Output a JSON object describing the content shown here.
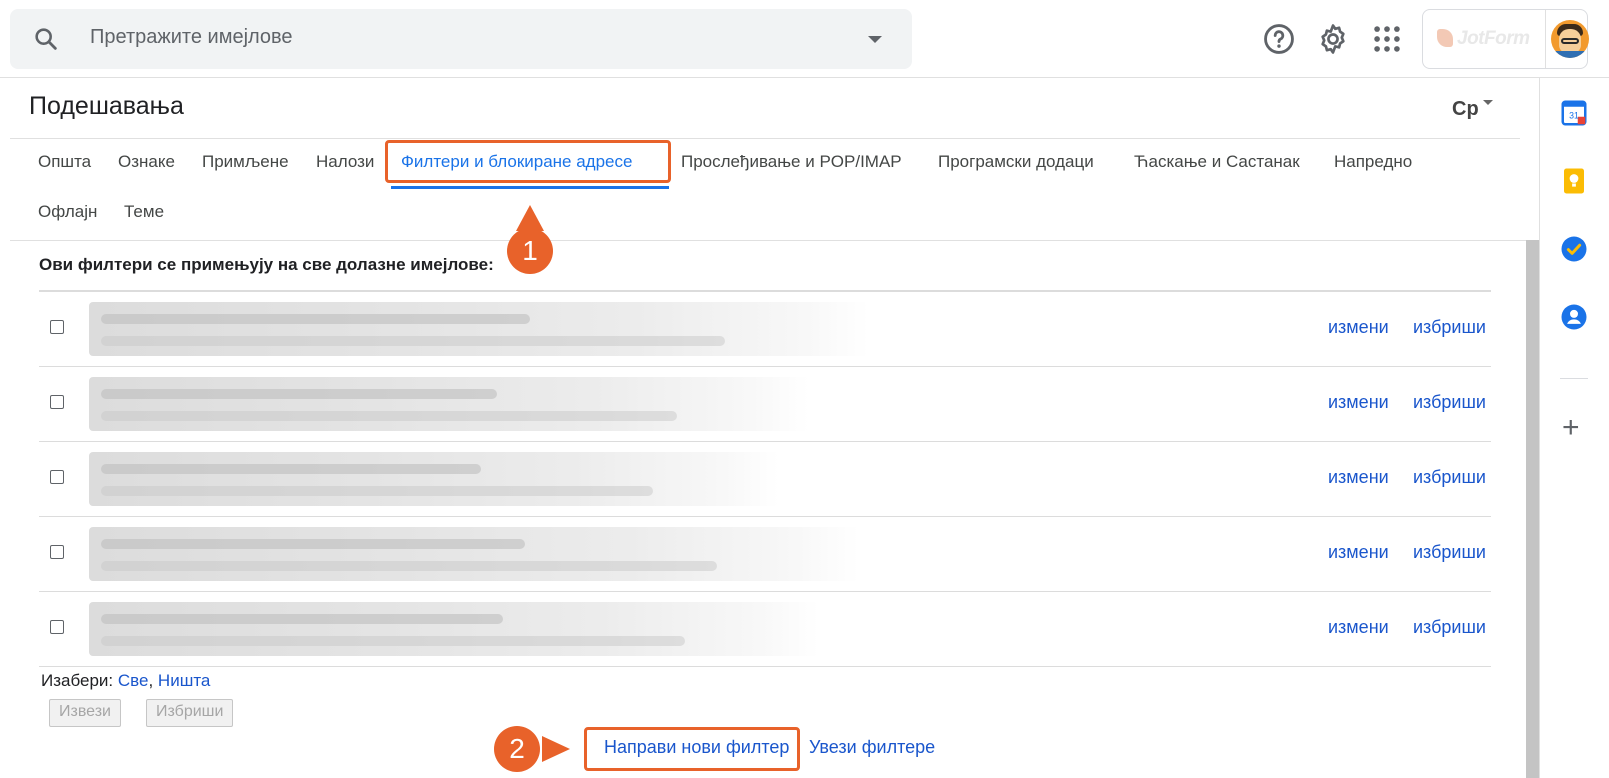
{
  "search": {
    "placeholder": "Претражите имејлове"
  },
  "topbar": {
    "help_icon": "help-icon",
    "settings_icon": "gear-icon",
    "apps_icon": "apps-grid-icon",
    "account_brand": "JotForm"
  },
  "settings": {
    "title": "Подешавања",
    "language_indicator": "Ср",
    "tabs": [
      {
        "label": "Општа"
      },
      {
        "label": "Ознаке"
      },
      {
        "label": "Примљене"
      },
      {
        "label": "Налози"
      },
      {
        "label": "Филтери и блокиране адресе",
        "active": true
      },
      {
        "label": "Прослеђивање и POP/IMAP"
      },
      {
        "label": "Програмски додаци"
      },
      {
        "label": "Ћаскање и Састанак"
      },
      {
        "label": "Напредно"
      },
      {
        "label": "Офлајн"
      },
      {
        "label": "Теме"
      }
    ]
  },
  "filters": {
    "heading": "Ови филтери се примењују на све долазне имејлове:",
    "rows": [
      {
        "edit": "измени",
        "delete": "избриши"
      },
      {
        "edit": "измени",
        "delete": "избриши"
      },
      {
        "edit": "измени",
        "delete": "избриши"
      },
      {
        "edit": "измени",
        "delete": "избриши"
      },
      {
        "edit": "измени",
        "delete": "избриши"
      }
    ],
    "select_label": "Изабери:",
    "select_all": "Све",
    "select_none": "Ништа",
    "export_button": "Извези",
    "delete_button": "Избриши",
    "create_new": "Направи нови филтер",
    "import": "Увези филтере"
  },
  "annotations": {
    "badge1": "1",
    "badge2": "2",
    "accent_color": "#e8622a"
  },
  "colors": {
    "link": "#1a56cc",
    "active_tab": "#1a73e8"
  }
}
